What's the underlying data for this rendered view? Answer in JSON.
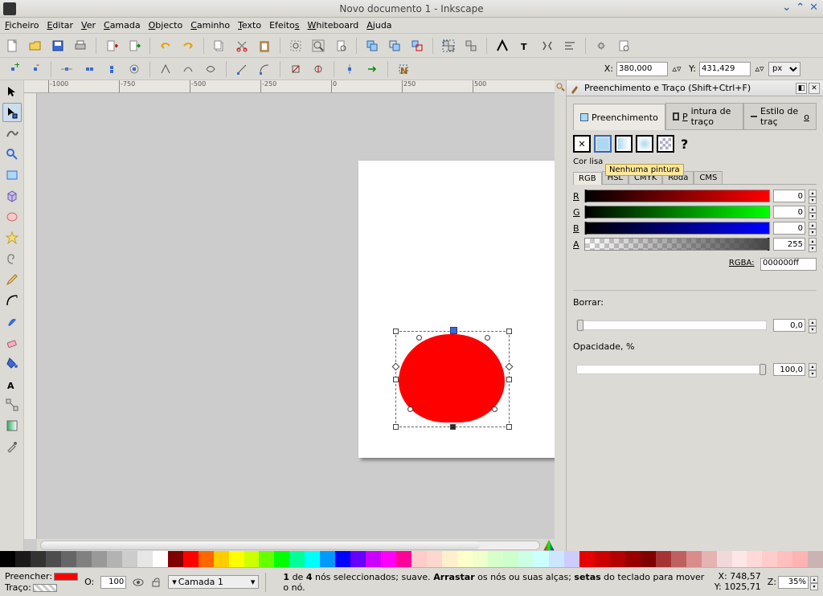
{
  "title": "Novo documento 1 - Inkscape",
  "menu": {
    "ficheiro": "Ficheiro",
    "editar": "Editar",
    "ver": "Ver",
    "camada": "Camada",
    "objecto": "Objecto",
    "caminho": "Caminho",
    "texto": "Texto",
    "efeitos": "Efeitos",
    "whiteboard": "Whiteboard",
    "ajuda": "Ajuda"
  },
  "ruler": {
    "ticks": [
      "-1000",
      "-750",
      "-500",
      "-250",
      "0",
      "250",
      "500"
    ]
  },
  "coords_toolbar": {
    "x_label": "X:",
    "x_value": "380,000",
    "y_label": "Y:",
    "y_value": "431,429",
    "unit": "px"
  },
  "dock": {
    "title": "Preenchimento e Traço (Shift+Ctrl+F)",
    "tabs": {
      "fill": "Preenchimento",
      "stroke_paint": "Pintura de traço",
      "stroke_style": "Estilo de traço"
    },
    "flat_label": "Cor lisa",
    "tooltip": "Nenhuma pintura",
    "color_tabs": {
      "rgb": "RGB",
      "hsl": "HSL",
      "cmyk": "CMYK",
      "wheel": "Roda",
      "cms": "CMS"
    },
    "channels": {
      "r": {
        "label": "R",
        "value": "0"
      },
      "g": {
        "label": "G",
        "value": "0"
      },
      "b": {
        "label": "B",
        "value": "0"
      },
      "a": {
        "label": "A",
        "value": "255"
      }
    },
    "rgba_label": "RGBA:",
    "rgba_value": "000000ff",
    "blur_label": "Borrar:",
    "blur_value": "0,0",
    "opacity_label": "Opacidade, %",
    "opacity_value": "100,0"
  },
  "palette": [
    "#000000",
    "#1a1a1a",
    "#333333",
    "#4d4d4d",
    "#666666",
    "#808080",
    "#999999",
    "#b3b3b3",
    "#cccccc",
    "#e6e6e6",
    "#ffffff",
    "#800000",
    "#ff0000",
    "#ff6600",
    "#ffcc00",
    "#ffff00",
    "#ccff00",
    "#66ff00",
    "#00ff00",
    "#00ff99",
    "#00ffff",
    "#0099ff",
    "#0000ff",
    "#6600ff",
    "#cc00ff",
    "#ff00ff",
    "#ff0099",
    "#ffcccc",
    "#ffd7cc",
    "#fff0cc",
    "#ffffcc",
    "#f0ffcc",
    "#d7ffcc",
    "#ccffcc",
    "#ccffe6",
    "#ccffff",
    "#cce6ff",
    "#ccccff",
    "#e60000",
    "#cc0000",
    "#b30000",
    "#990000",
    "#800000",
    "#a63333",
    "#bf6060",
    "#d98c8c",
    "#e6b3b3",
    "#f2d9d9",
    "#ffe6e6",
    "#ffd9d9",
    "#ffcccc",
    "#ffbfbf",
    "#ffb3b3",
    "#ccb3b3"
  ],
  "status": {
    "fill_label": "Preencher:",
    "fill_color": "#ff0000",
    "stroke_label": "Traço:",
    "opacity_label": "O:",
    "opacity_value": "100",
    "layer_name": "Camada 1",
    "msg_1": "1",
    "msg_de": "de",
    "msg_4": "4",
    "msg_text1": "nós seleccionados; suave.",
    "msg_arrastar": "Arrastar",
    "msg_text2": "os nós ou suas alças;",
    "msg_setas": "setas",
    "msg_text3": "do teclado para mover o nó.",
    "coord_x_lab": "X:",
    "coord_x": "748,57",
    "coord_y_lab": "Y:",
    "coord_y": "1025,71",
    "zoom_label": "Z:",
    "zoom_value": "35%"
  }
}
